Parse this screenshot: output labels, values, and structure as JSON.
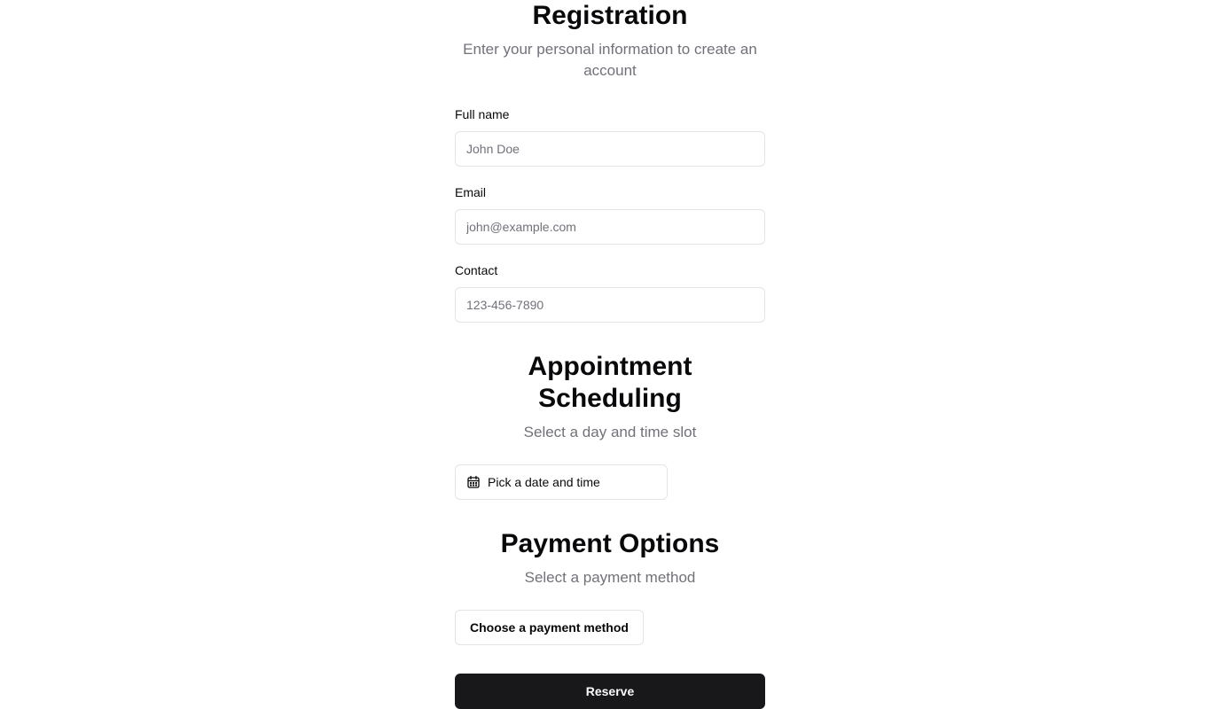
{
  "registration": {
    "title": "Registration",
    "subtitle": "Enter your personal information to create an account",
    "fields": [
      {
        "label": "Full name",
        "placeholder": "John Doe"
      },
      {
        "label": "Email",
        "placeholder": "john@example.com"
      },
      {
        "label": "Contact",
        "placeholder": "123-456-7890"
      }
    ]
  },
  "appointment": {
    "title": "Appointment Scheduling",
    "subtitle": "Select a day and time slot",
    "picker_label": "Pick a date and time",
    "picker_icon": "calendar-icon"
  },
  "payment": {
    "title": "Payment Options",
    "subtitle": "Select a payment method",
    "button_label": "Choose a payment method"
  },
  "actions": {
    "reserve_label": "Reserve"
  },
  "colors": {
    "primary_button": "#18181b",
    "border": "#e4e4e7",
    "muted_text": "#71717a"
  }
}
